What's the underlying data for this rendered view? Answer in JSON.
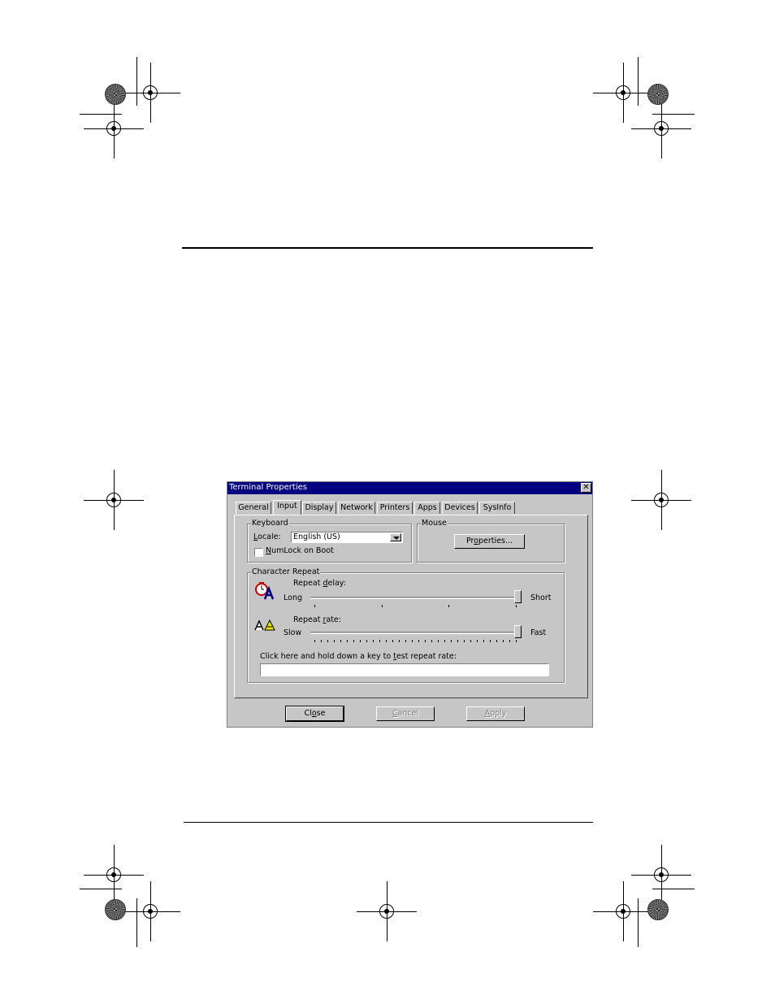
{
  "window": {
    "title": "Terminal Properties",
    "close_glyph": "✕"
  },
  "tabs": [
    {
      "label": "General"
    },
    {
      "label": "Input"
    },
    {
      "label": "Display"
    },
    {
      "label": "Network"
    },
    {
      "label": "Printers"
    },
    {
      "label": "Apps"
    },
    {
      "label": "Devices"
    },
    {
      "label": "SysInfo"
    }
  ],
  "active_tab": "Input",
  "keyboard": {
    "group_label": "Keyboard",
    "locale_label": "Locale:",
    "locale_value": "English (US)",
    "numlock_label": "NumLock on Boot",
    "numlock_checked": false
  },
  "mouse": {
    "group_label": "Mouse",
    "properties_button": "Properties..."
  },
  "character_repeat": {
    "group_label": "Character Repeat",
    "delay_label": "Repeat delay:",
    "delay_min_label": "Long",
    "delay_max_label": "Short",
    "delay_level": 1.0,
    "rate_label": "Repeat rate:",
    "rate_min_label": "Slow",
    "rate_max_label": "Fast",
    "rate_level": 1.0,
    "test_label": "Click here and hold down a key to test repeat rate:",
    "test_value": ""
  },
  "buttons": {
    "close": "Close",
    "cancel": "Cancel",
    "apply": "Apply"
  },
  "icons": {
    "delay": "clock-letter-a-icon",
    "rate": "double-letter-a-icon"
  }
}
